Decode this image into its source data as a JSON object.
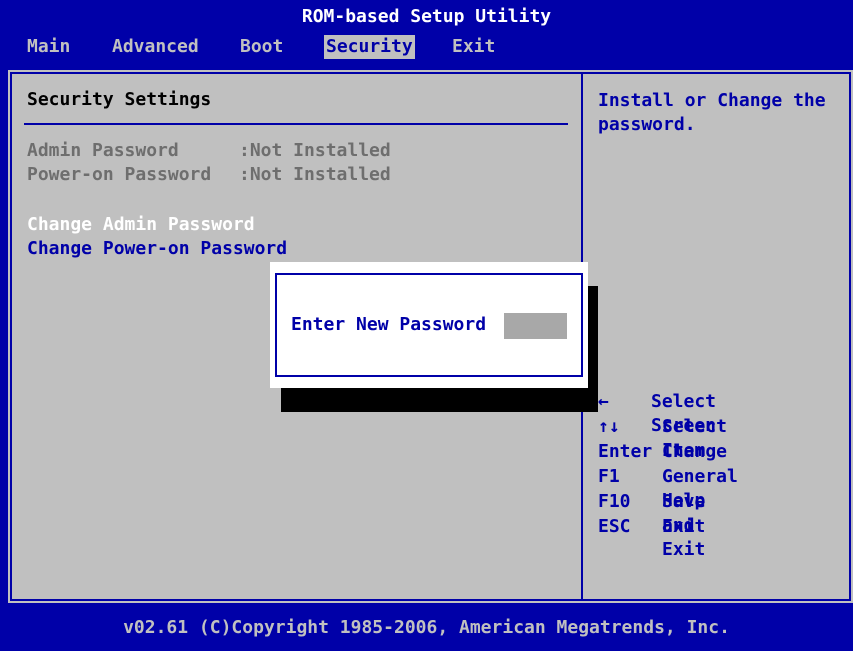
{
  "title": "ROM-based Setup Utility",
  "menu": {
    "tabs": [
      {
        "label": "Main"
      },
      {
        "label": "Advanced"
      },
      {
        "label": "Boot"
      },
      {
        "label": "Security"
      },
      {
        "label": "Exit"
      }
    ],
    "active_tab": "Security"
  },
  "security": {
    "section_title": "Security Settings",
    "admin_password": {
      "label": "Admin Password",
      "value": ":Not Installed"
    },
    "poweron_password": {
      "label": "Power-on Password",
      "value": ":Not Installed"
    },
    "change_admin": "Change Admin Password",
    "change_poweron": "Change Power-on Password"
  },
  "help": {
    "text": "Install or Change the password."
  },
  "keys": [
    {
      "key": "←",
      "action": "Select Screen"
    },
    {
      "key": "↑↓",
      "action": "Select Item"
    },
    {
      "key": "Enter",
      "action": "Change"
    },
    {
      "key": "F1",
      "action": "General Help"
    },
    {
      "key": "F10",
      "action": "Save and Exit"
    },
    {
      "key": "ESC",
      "action": "Exit"
    }
  ],
  "dialog": {
    "prompt": "Enter New Password",
    "input_value": ""
  },
  "footer": "v02.61 (C)Copyright 1985-2006, American Megatrends, Inc.",
  "colors": {
    "background": "#0000a8",
    "panel": "#c0c0c0",
    "highlight_text": "#ffffff",
    "dimmed_text": "#6e6e6e"
  }
}
